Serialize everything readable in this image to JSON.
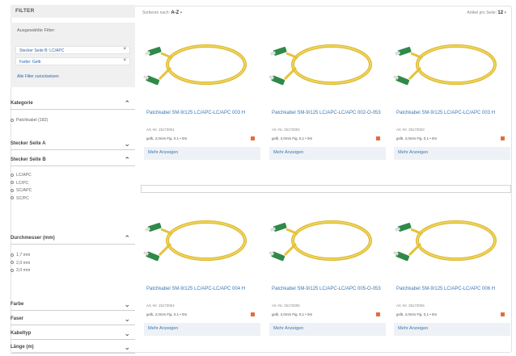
{
  "sidebar": {
    "title": "FILTER",
    "selected_title": "Ausgewählte Filter:",
    "chips": [
      "Stecker Seite B: LC/APC",
      "Farbe: Gelb"
    ],
    "chip_remove": "×",
    "reset_label": "Alle Filter zurücksetzen",
    "sections": [
      {
        "label": "Kategorie",
        "open": true,
        "options": [
          "Patchkabel (182)"
        ]
      },
      {
        "label": "Stecker Seite A",
        "open": false,
        "options": []
      },
      {
        "label": "Stecker Seite B",
        "open": true,
        "options": [
          "LC/APC",
          "LC/PC",
          "SC/APC",
          "SC/PC"
        ]
      },
      {
        "label": "Durchmesser (mm)",
        "open": true,
        "options": [
          "1,7 mm",
          "2,0 mm",
          "3,0 mm"
        ]
      },
      {
        "label": "Farbe",
        "open": false,
        "options": []
      },
      {
        "label": "Faser",
        "open": false,
        "options": []
      },
      {
        "label": "Kabeltyp",
        "open": false,
        "options": []
      },
      {
        "label": "Länge (m)",
        "open": false,
        "options": []
      }
    ],
    "chevron_up": "⌃",
    "chevron_down": "⌄"
  },
  "toolbar": {
    "sort_prefix": "Sortieren nach:",
    "sort_value": "A-Z",
    "perpage_prefix": "Artikel pro Seite:",
    "perpage_value": "12"
  },
  "products": [
    {
      "name": "Patchkabel SM-9/125 LC/APC-LC/APC 003 H",
      "artnr": "Art.-Nr. 25173001",
      "attr": "gelb, 2,0mm Fig. 0,1 • 0m",
      "more": "Mehr Anzeigen"
    },
    {
      "name": "Patchkabel SM-9/125 LC/APC-LC/APC 002-O-053",
      "artnr": "Art.-Nr. 25173002",
      "attr": "gelb, 2,0mm Fig. 0,1 • 0m",
      "more": "Mehr Anzeigen"
    },
    {
      "name": "Patchkabel SM-9/125 LC/APC-LC/APC 003 H",
      "artnr": "Art.-Nr. 25173003",
      "attr": "gelb, 2,0mm Fig. 0,1 • 0m",
      "more": "Mehr Anzeigen"
    },
    {
      "name": "Patchkabel SM-9/125 LC/APC-LC/APC 004 H",
      "artnr": "Art.-Nr. 25173004",
      "attr": "gelb, 2,0mm Fig. 0,1 • 0m",
      "more": "Mehr Anzeigen"
    },
    {
      "name": "Patchkabel SM-9/125 LC/APC-LC/APC 005-O-053",
      "artnr": "Art.-Nr. 25173005",
      "attr": "gelb, 2,0mm Fig. 0,1 • 0m",
      "more": "Mehr Anzeigen"
    },
    {
      "name": "Patchkabel SM-9/125 LC/APC-LC/APC 006 H",
      "artnr": "Art.-Nr. 25173006",
      "attr": "gelb, 2,0mm Fig. 0,1 • 0m",
      "more": "Mehr Anzeigen"
    }
  ],
  "colors": {
    "accent": "#3b78b5",
    "stock": "#e0703a",
    "cable": "#e4c23a",
    "connector": "#2f8a4a"
  },
  "icons": {
    "product_image": "fiber-patch-cable-image",
    "stock": "stock-indicator-icon"
  }
}
